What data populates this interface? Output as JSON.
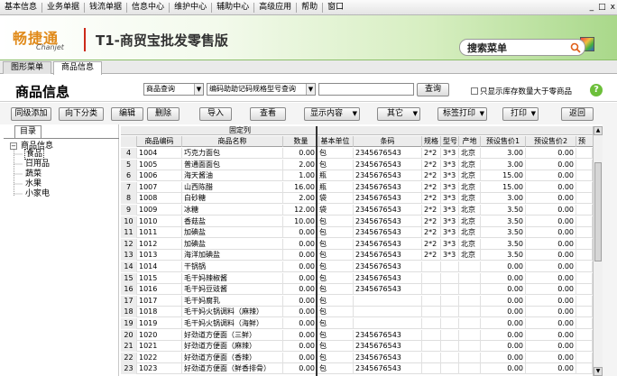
{
  "menubar": {
    "items": [
      "基本信息",
      "业务单据",
      "钱流单据",
      "信息中心",
      "维护中心",
      "辅助中心",
      "高级应用",
      "帮助",
      "窗口"
    ],
    "window_controls": [
      "_",
      "□",
      "x"
    ]
  },
  "banner": {
    "logo_cn": "畅捷通",
    "logo_en": "Chanjet",
    "product_name": "T1-商贸宝批发零售版",
    "search_label": "搜索菜单"
  },
  "tabs": [
    {
      "label": "图形菜单"
    },
    {
      "label": "商品信息"
    }
  ],
  "page": {
    "title": "商品信息",
    "query_mode": "商品查询",
    "filter_field": "编码助助记码规格型号查询",
    "query_value": "",
    "query_button": "查询",
    "stock_checkbox_label": "只显示库存数量大于零商品",
    "help_icon": "?"
  },
  "toolbar": {
    "add_peer": "同级添加",
    "add_child": "向下分类",
    "edit": "编辑",
    "delete": "删除",
    "import": "导入",
    "view": "查看",
    "display": "显示内容",
    "other": "其它",
    "label_print": "标签打印",
    "print": "打印",
    "back": "返回"
  },
  "sidebar": {
    "tab_label": "目录",
    "tree": {
      "root": "商品信息",
      "toggle": "−",
      "children": [
        "食品",
        "日用品",
        "蔬菜",
        "水果",
        "小家电"
      ]
    }
  },
  "grid": {
    "fixed_label": "固定列",
    "columns": [
      "商品编码",
      "商品名称",
      "数量",
      "基本单位",
      "条码",
      "规格",
      "型号",
      "产地",
      "预设售价1",
      "预设售价2",
      "预"
    ],
    "rows": [
      {
        "n": "4",
        "code": "1004",
        "name": "巧克力面包",
        "qty": "0.00",
        "unit": "包",
        "barcode": "2345676543",
        "spec": "2*2",
        "model": "3*3",
        "origin": "北京",
        "p1": "3.00",
        "p2": "0.00"
      },
      {
        "n": "5",
        "code": "1005",
        "name": "普通面面包",
        "qty": "2.00",
        "unit": "包",
        "barcode": "2345676543",
        "spec": "2*2",
        "model": "3*3",
        "origin": "北京",
        "p1": "3.00",
        "p2": "0.00"
      },
      {
        "n": "6",
        "code": "1006",
        "name": "海天酱油",
        "qty": "1.00",
        "unit": "瓶",
        "barcode": "2345676543",
        "spec": "2*2",
        "model": "3*3",
        "origin": "北京",
        "p1": "15.00",
        "p2": "0.00"
      },
      {
        "n": "7",
        "code": "1007",
        "name": "山西陈醋",
        "qty": "16.00",
        "unit": "瓶",
        "barcode": "2345676543",
        "spec": "2*2",
        "model": "3*3",
        "origin": "北京",
        "p1": "15.00",
        "p2": "0.00"
      },
      {
        "n": "8",
        "code": "1008",
        "name": "白砂糖",
        "qty": "2.00",
        "unit": "袋",
        "barcode": "2345676543",
        "spec": "2*2",
        "model": "3*3",
        "origin": "北京",
        "p1": "3.00",
        "p2": "0.00"
      },
      {
        "n": "9",
        "code": "1009",
        "name": "冰糖",
        "qty": "12.00",
        "unit": "袋",
        "barcode": "2345676543",
        "spec": "2*2",
        "model": "3*3",
        "origin": "北京",
        "p1": "3.50",
        "p2": "0.00"
      },
      {
        "n": "10",
        "code": "1010",
        "name": "香菇盐",
        "qty": "10.00",
        "unit": "包",
        "barcode": "2345676543",
        "spec": "2*2",
        "model": "3*3",
        "origin": "北京",
        "p1": "3.50",
        "p2": "0.00"
      },
      {
        "n": "11",
        "code": "1011",
        "name": "加碘盐",
        "qty": "0.00",
        "unit": "包",
        "barcode": "2345676543",
        "spec": "2*2",
        "model": "3*3",
        "origin": "北京",
        "p1": "3.50",
        "p2": "0.00"
      },
      {
        "n": "12",
        "code": "1012",
        "name": "加碘盐",
        "qty": "0.00",
        "unit": "包",
        "barcode": "2345676543",
        "spec": "2*2",
        "model": "3*3",
        "origin": "北京",
        "p1": "3.50",
        "p2": "0.00"
      },
      {
        "n": "13",
        "code": "1013",
        "name": "海洋加碘盐",
        "qty": "0.00",
        "unit": "包",
        "barcode": "2345676543",
        "spec": "2*2",
        "model": "3*3",
        "origin": "北京",
        "p1": "3.50",
        "p2": "0.00"
      },
      {
        "n": "14",
        "code": "1014",
        "name": "干锅锅",
        "qty": "0.00",
        "unit": "包",
        "barcode": "2345676543",
        "spec": "",
        "model": "",
        "origin": "",
        "p1": "0.00",
        "p2": "0.00"
      },
      {
        "n": "15",
        "code": "1015",
        "name": "毛干妈辣椒酱",
        "qty": "0.00",
        "unit": "包",
        "barcode": "2345676543",
        "spec": "",
        "model": "",
        "origin": "",
        "p1": "0.00",
        "p2": "0.00"
      },
      {
        "n": "16",
        "code": "1016",
        "name": "毛干妈豆豉酱",
        "qty": "0.00",
        "unit": "包",
        "barcode": "2345676543",
        "spec": "",
        "model": "",
        "origin": "",
        "p1": "0.00",
        "p2": "0.00"
      },
      {
        "n": "17",
        "code": "1017",
        "name": "毛干妈腐乳",
        "qty": "0.00",
        "unit": "包",
        "barcode": "",
        "spec": "",
        "model": "",
        "origin": "",
        "p1": "0.00",
        "p2": "0.00"
      },
      {
        "n": "18",
        "code": "1018",
        "name": "毛干妈火锅调料（麻辣）",
        "qty": "0.00",
        "unit": "包",
        "barcode": "",
        "spec": "",
        "model": "",
        "origin": "",
        "p1": "0.00",
        "p2": "0.00"
      },
      {
        "n": "19",
        "code": "1019",
        "name": "毛干妈火锅调料（海鲜）",
        "qty": "0.00",
        "unit": "包",
        "barcode": "",
        "spec": "",
        "model": "",
        "origin": "",
        "p1": "0.00",
        "p2": "0.00"
      },
      {
        "n": "20",
        "code": "1020",
        "name": "好劲道方便面（三鲜）",
        "qty": "0.00",
        "unit": "包",
        "barcode": "2345676543",
        "spec": "",
        "model": "",
        "origin": "",
        "p1": "0.00",
        "p2": "0.00"
      },
      {
        "n": "21",
        "code": "1021",
        "name": "好劲道方便面（麻辣）",
        "qty": "0.00",
        "unit": "包",
        "barcode": "2345676543",
        "spec": "",
        "model": "",
        "origin": "",
        "p1": "0.00",
        "p2": "0.00"
      },
      {
        "n": "22",
        "code": "1022",
        "name": "好劲道方便面（香辣）",
        "qty": "0.00",
        "unit": "包",
        "barcode": "2345676543",
        "spec": "",
        "model": "",
        "origin": "",
        "p1": "0.00",
        "p2": "0.00"
      },
      {
        "n": "23",
        "code": "1023",
        "name": "好劲道方便面（鲜香排骨）",
        "qty": "0.00",
        "unit": "包",
        "barcode": "2345676543",
        "spec": "",
        "model": "",
        "origin": "",
        "p1": "0.00",
        "p2": "0.00"
      }
    ]
  }
}
